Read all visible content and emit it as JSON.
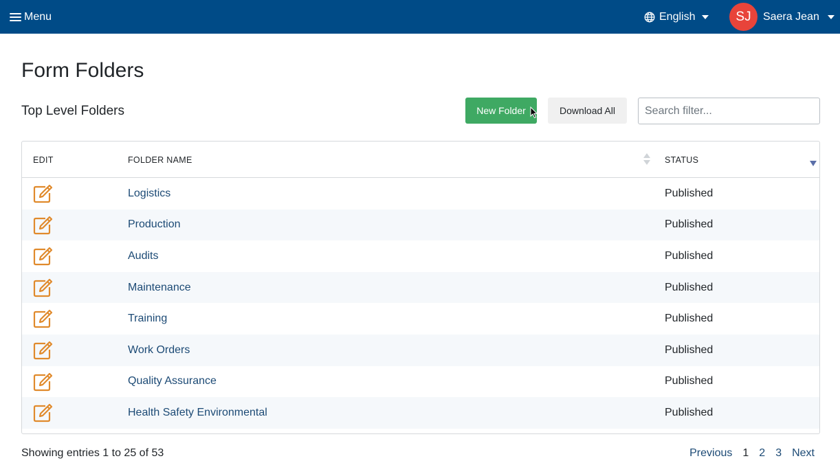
{
  "topbar": {
    "menu_label": "Menu",
    "language_label": "English",
    "user": {
      "initials": "SJ",
      "name": "Saera Jean"
    }
  },
  "page": {
    "title": "Form Folders",
    "section_title": "Top Level Folders"
  },
  "toolbar": {
    "new_folder_label": "New Folder",
    "download_all_label": "Download All",
    "search_placeholder": "Search filter..."
  },
  "table": {
    "headers": {
      "edit": "EDIT",
      "name": "FOLDER NAME",
      "status": "STATUS"
    },
    "rows": [
      {
        "name": "Logistics",
        "status": "Published"
      },
      {
        "name": "Production",
        "status": "Published"
      },
      {
        "name": "Audits",
        "status": "Published"
      },
      {
        "name": "Maintenance",
        "status": "Published"
      },
      {
        "name": "Training",
        "status": "Published"
      },
      {
        "name": "Work Orders",
        "status": "Published"
      },
      {
        "name": "Quality Assurance",
        "status": "Published"
      },
      {
        "name": "Health Safety Environmental",
        "status": "Published"
      }
    ]
  },
  "footer": {
    "info": "Showing entries 1 to 25 of 53",
    "pagination": {
      "previous": "Previous",
      "pages": [
        "1",
        "2",
        "3"
      ],
      "current": "1",
      "next": "Next"
    }
  },
  "icons": {
    "menu": "hamburger-icon",
    "language": "globe-icon",
    "edit": "edit-icon",
    "sort": "sort-icon",
    "dropdown": "caret-down-icon"
  },
  "colors": {
    "topbar": "#004b87",
    "primary_button": "#3fa963",
    "avatar": "#e8443a",
    "edit_icon": "#e08a2c",
    "link": "#1c4a75"
  }
}
